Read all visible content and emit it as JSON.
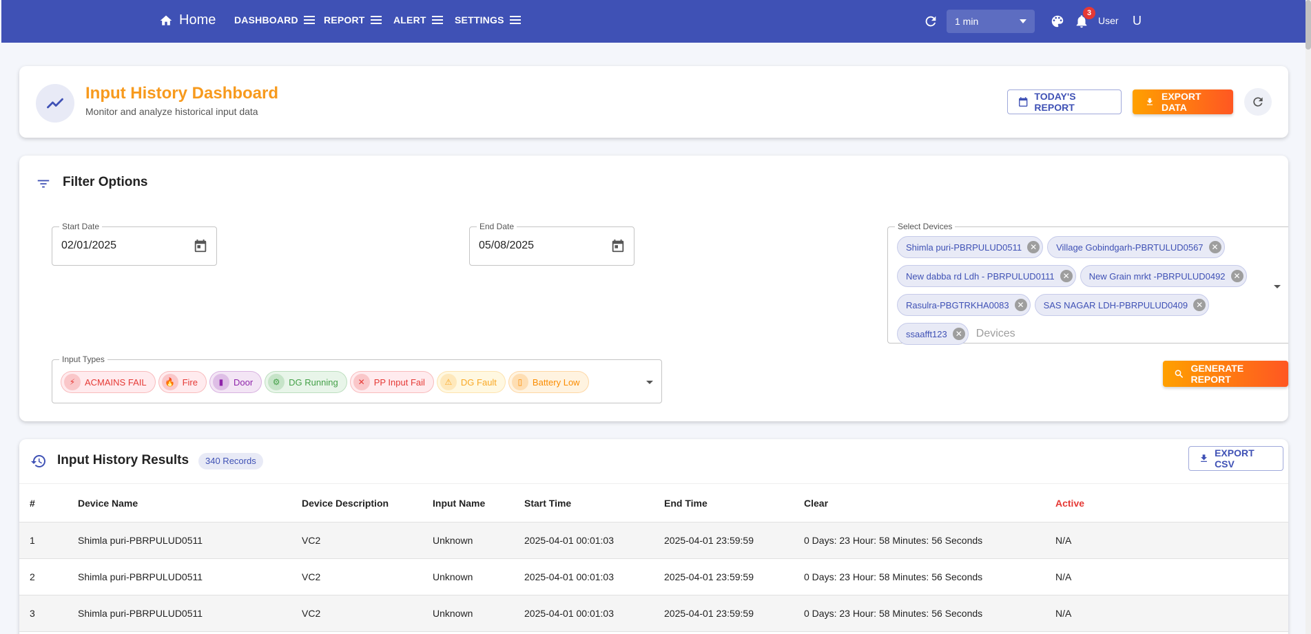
{
  "nav": {
    "home": "Home",
    "items": [
      "DASHBOARD",
      "REPORT",
      "ALERT",
      "SETTINGS"
    ],
    "refresh_interval": "1 min",
    "notification_count": "3",
    "user_label": "User",
    "user_initial": "U"
  },
  "header": {
    "title": "Input History Dashboard",
    "subtitle": "Monitor and analyze historical input data",
    "todays_report": "TODAY'S REPORT",
    "export_data": "EXPORT DATA"
  },
  "filters": {
    "title": "Filter Options",
    "start_date_label": "Start Date",
    "start_date": "02/01/2025",
    "end_date_label": "End Date",
    "end_date": "05/08/2025",
    "devices_label": "Select Devices",
    "devices": [
      "Shimla puri-PBRPULUD0511",
      "Village Gobindgarh-PBRTULUD0567",
      "New dabba rd Ldh - PBRPULUD0111",
      "New Grain mrkt -PBRPULUD0492",
      "Rasulra-PBGTRKHA0083",
      "SAS NAGAR LDH-PBRPULUD0409",
      "ssaafft123"
    ],
    "devices_placeholder": "Devices",
    "input_types_label": "Input Types",
    "input_types": [
      {
        "label": "ACMAINS FAIL",
        "icon": "⚡",
        "color": "#e53935",
        "bg": "#ffebee"
      },
      {
        "label": "Fire",
        "icon": "🔥",
        "color": "#e53935",
        "bg": "#ffebee"
      },
      {
        "label": "Door",
        "icon": "▮",
        "color": "#8e24aa",
        "bg": "#f3e5f5"
      },
      {
        "label": "DG Running",
        "icon": "⚙",
        "color": "#43a047",
        "bg": "#e8f5e9"
      },
      {
        "label": "PP Input Fail",
        "icon": "✕",
        "color": "#e53935",
        "bg": "#ffebee"
      },
      {
        "label": "DG Fault",
        "icon": "⚠",
        "color": "#f9a825",
        "bg": "#fff8e1"
      },
      {
        "label": "Battery Low",
        "icon": "▯",
        "color": "#fb8c00",
        "bg": "#fff3e0"
      }
    ],
    "generate_report": "GENERATE REPORT"
  },
  "results": {
    "title": "Input History Results",
    "record_count": "340 Records",
    "export_csv": "EXPORT CSV",
    "columns": [
      "#",
      "Device Name",
      "Device Description",
      "Input Name",
      "Start Time",
      "End Time",
      "Clear",
      "Active"
    ],
    "rows": [
      [
        "1",
        "Shimla puri-PBRPULUD0511",
        "VC2",
        "Unknown",
        "2025-04-01 00:01:03",
        "2025-04-01 23:59:59",
        "0 Days: 23 Hour: 58 Minutes: 56 Seconds",
        "N/A"
      ],
      [
        "2",
        "Shimla puri-PBRPULUD0511",
        "VC2",
        "Unknown",
        "2025-04-01 00:01:03",
        "2025-04-01 23:59:59",
        "0 Days: 23 Hour: 58 Minutes: 56 Seconds",
        "N/A"
      ],
      [
        "3",
        "Shimla puri-PBRPULUD0511",
        "VC2",
        "Unknown",
        "2025-04-01 00:01:03",
        "2025-04-01 23:59:59",
        "0 Days: 23 Hour: 58 Minutes: 56 Seconds",
        "N/A"
      ]
    ]
  },
  "colors": {
    "primary": "#3f51b5",
    "accent_orange": "#ff9800",
    "active_red": "#e53935"
  }
}
